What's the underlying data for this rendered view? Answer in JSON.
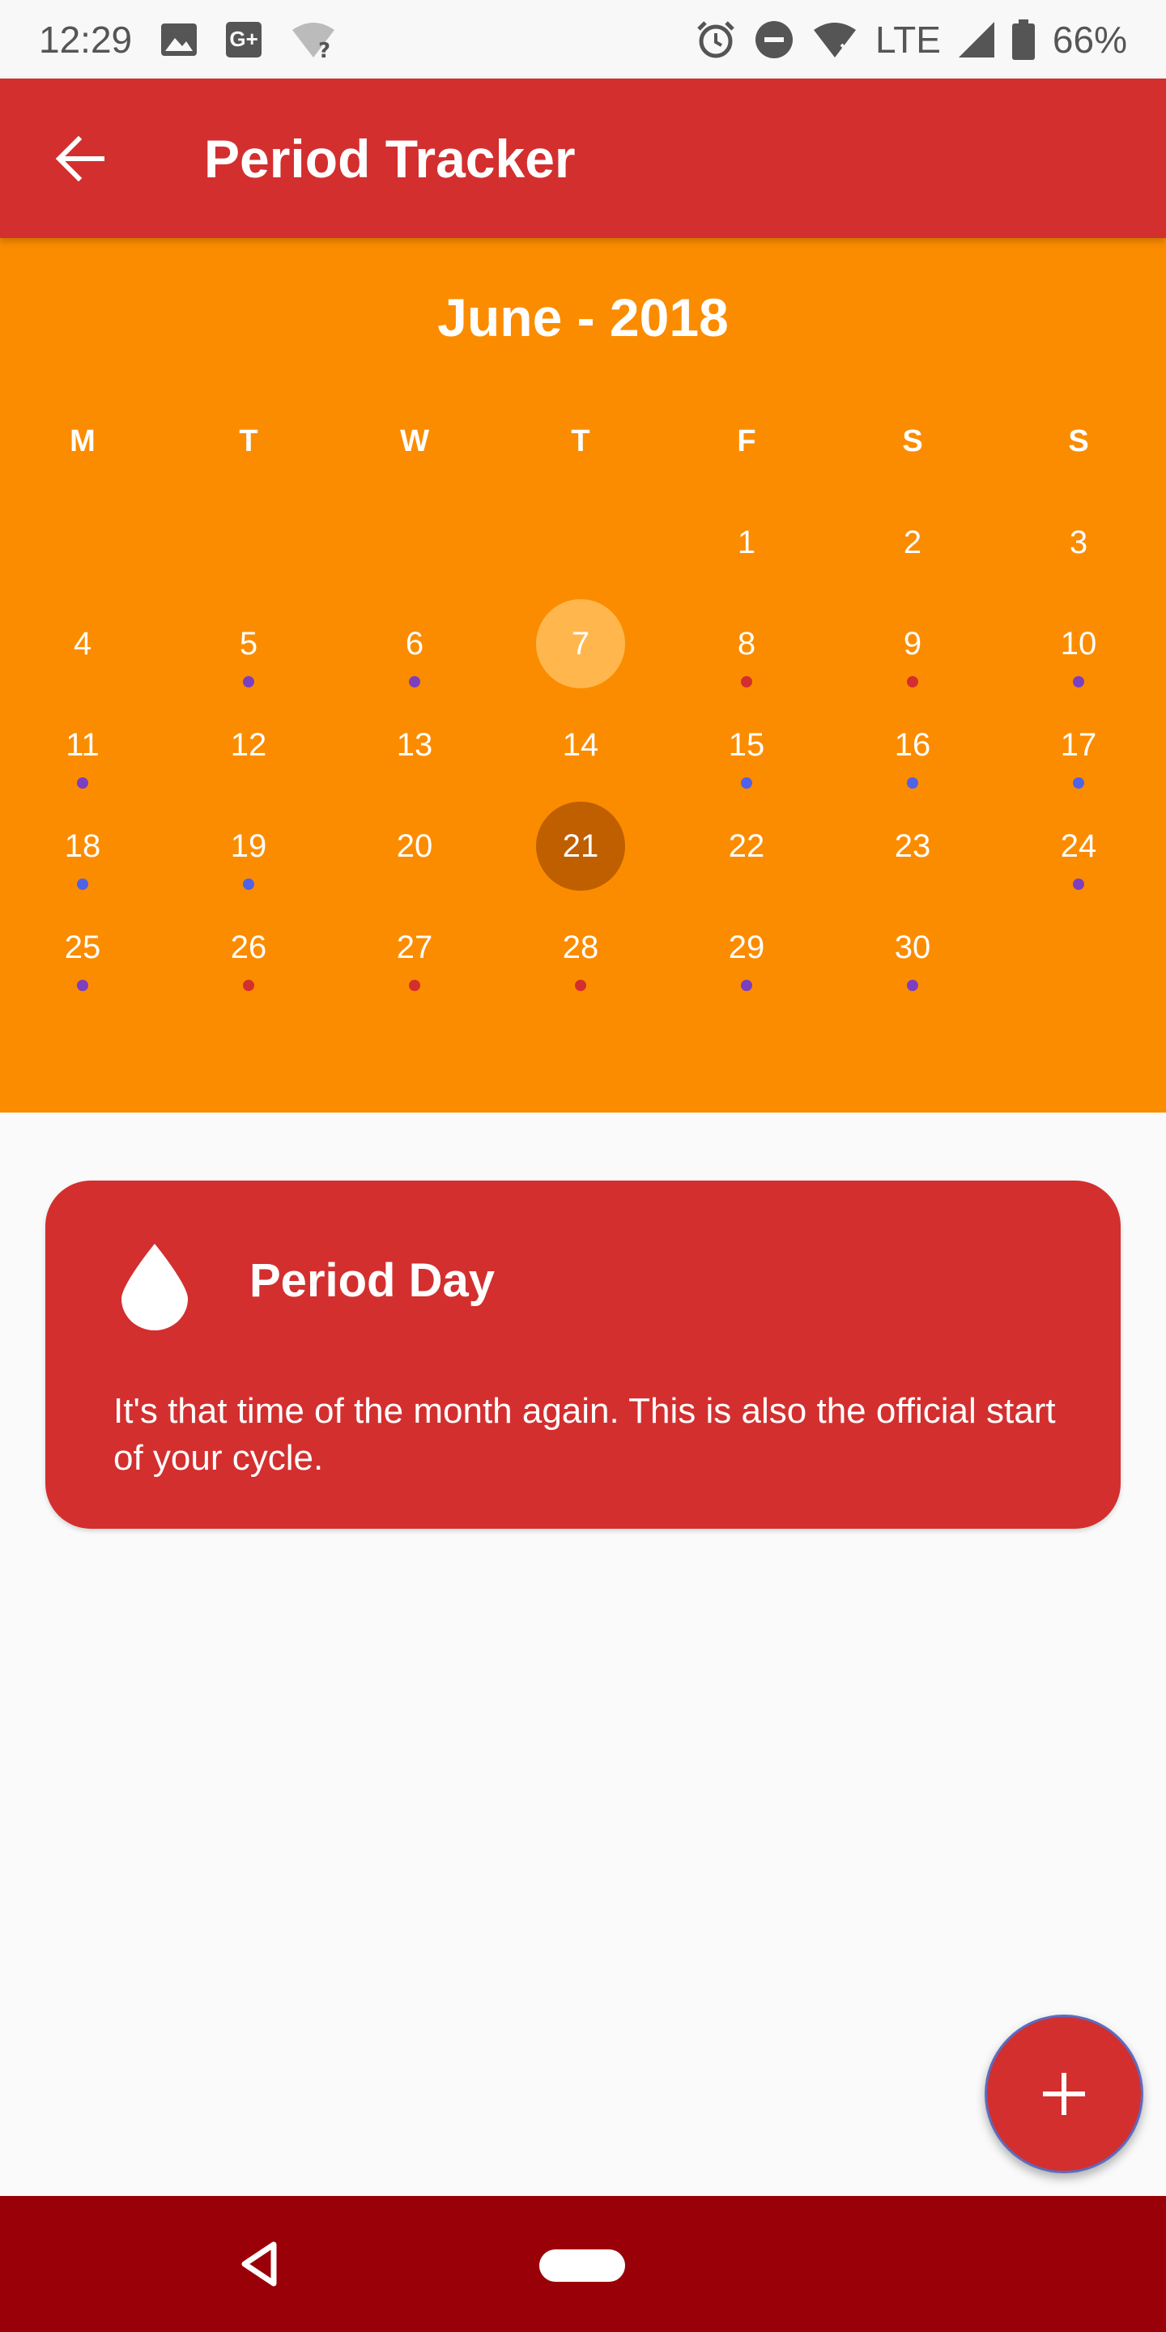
{
  "status_bar": {
    "time": "12:29",
    "gplus": "G+",
    "network": "LTE",
    "battery": "66%"
  },
  "app_bar": {
    "title": "Period Tracker"
  },
  "calendar": {
    "month_title": "June - 2018",
    "weekdays": [
      "M",
      "T",
      "W",
      "T",
      "F",
      "S",
      "S"
    ],
    "today": 7,
    "selected": 21,
    "first_weekday_index": 4,
    "days": [
      {
        "n": 1,
        "dot": null
      },
      {
        "n": 2,
        "dot": null
      },
      {
        "n": 3,
        "dot": null
      },
      {
        "n": 4,
        "dot": null
      },
      {
        "n": 5,
        "dot": "purple"
      },
      {
        "n": 6,
        "dot": "purple"
      },
      {
        "n": 7,
        "dot": null
      },
      {
        "n": 8,
        "dot": "red"
      },
      {
        "n": 9,
        "dot": "red"
      },
      {
        "n": 10,
        "dot": "purple"
      },
      {
        "n": 11,
        "dot": "purple"
      },
      {
        "n": 12,
        "dot": null
      },
      {
        "n": 13,
        "dot": null
      },
      {
        "n": 14,
        "dot": null
      },
      {
        "n": 15,
        "dot": "blue"
      },
      {
        "n": 16,
        "dot": "blue"
      },
      {
        "n": 17,
        "dot": "blue"
      },
      {
        "n": 18,
        "dot": "blue"
      },
      {
        "n": 19,
        "dot": "blue"
      },
      {
        "n": 20,
        "dot": null
      },
      {
        "n": 21,
        "dot": null
      },
      {
        "n": 22,
        "dot": null
      },
      {
        "n": 23,
        "dot": null
      },
      {
        "n": 24,
        "dot": "purple"
      },
      {
        "n": 25,
        "dot": "purple"
      },
      {
        "n": 26,
        "dot": "red"
      },
      {
        "n": 27,
        "dot": "red"
      },
      {
        "n": 28,
        "dot": "red"
      },
      {
        "n": 29,
        "dot": "purple"
      },
      {
        "n": 30,
        "dot": "purple"
      }
    ],
    "dot_colors": {
      "red": "#d32f2f",
      "purple": "#7b3fbf",
      "blue": "#4f62e8"
    }
  },
  "card": {
    "icon": "drop-icon",
    "title": "Period Day",
    "text": "It's that time of the month again. This is also the official start of your cycle."
  },
  "fab": {
    "icon": "plus-icon"
  },
  "colors": {
    "app_bar": "#d32f2f",
    "calendar_bg": "#fb8c00",
    "today": "#ffb74d",
    "selected": "#bf5f00",
    "nav_bar": "#9a0007"
  }
}
